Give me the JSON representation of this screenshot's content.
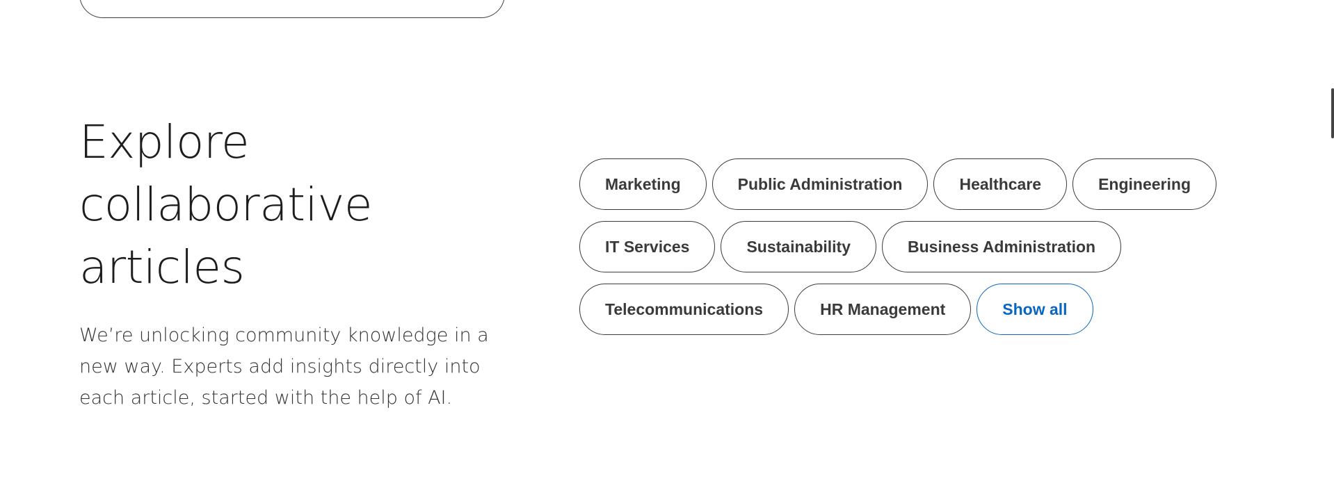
{
  "section": {
    "title_lines": [
      "Explore",
      "collaborative",
      "articles"
    ],
    "description": "We’re unlocking community knowledge in a new way. Experts add insights directly into each article, started with the help of AI."
  },
  "topics": {
    "rows": [
      [
        "Marketing",
        "Public Administration",
        "Healthcare",
        "Engineering"
      ],
      [
        "IT Services",
        "Sustainability",
        "Business Administration"
      ],
      [
        "Telecommunications",
        "HR Management"
      ]
    ],
    "show_all_label": "Show all"
  },
  "colors": {
    "accent": "#0a66c2",
    "text": "#191919",
    "pill_border": "#3b3b3b"
  }
}
